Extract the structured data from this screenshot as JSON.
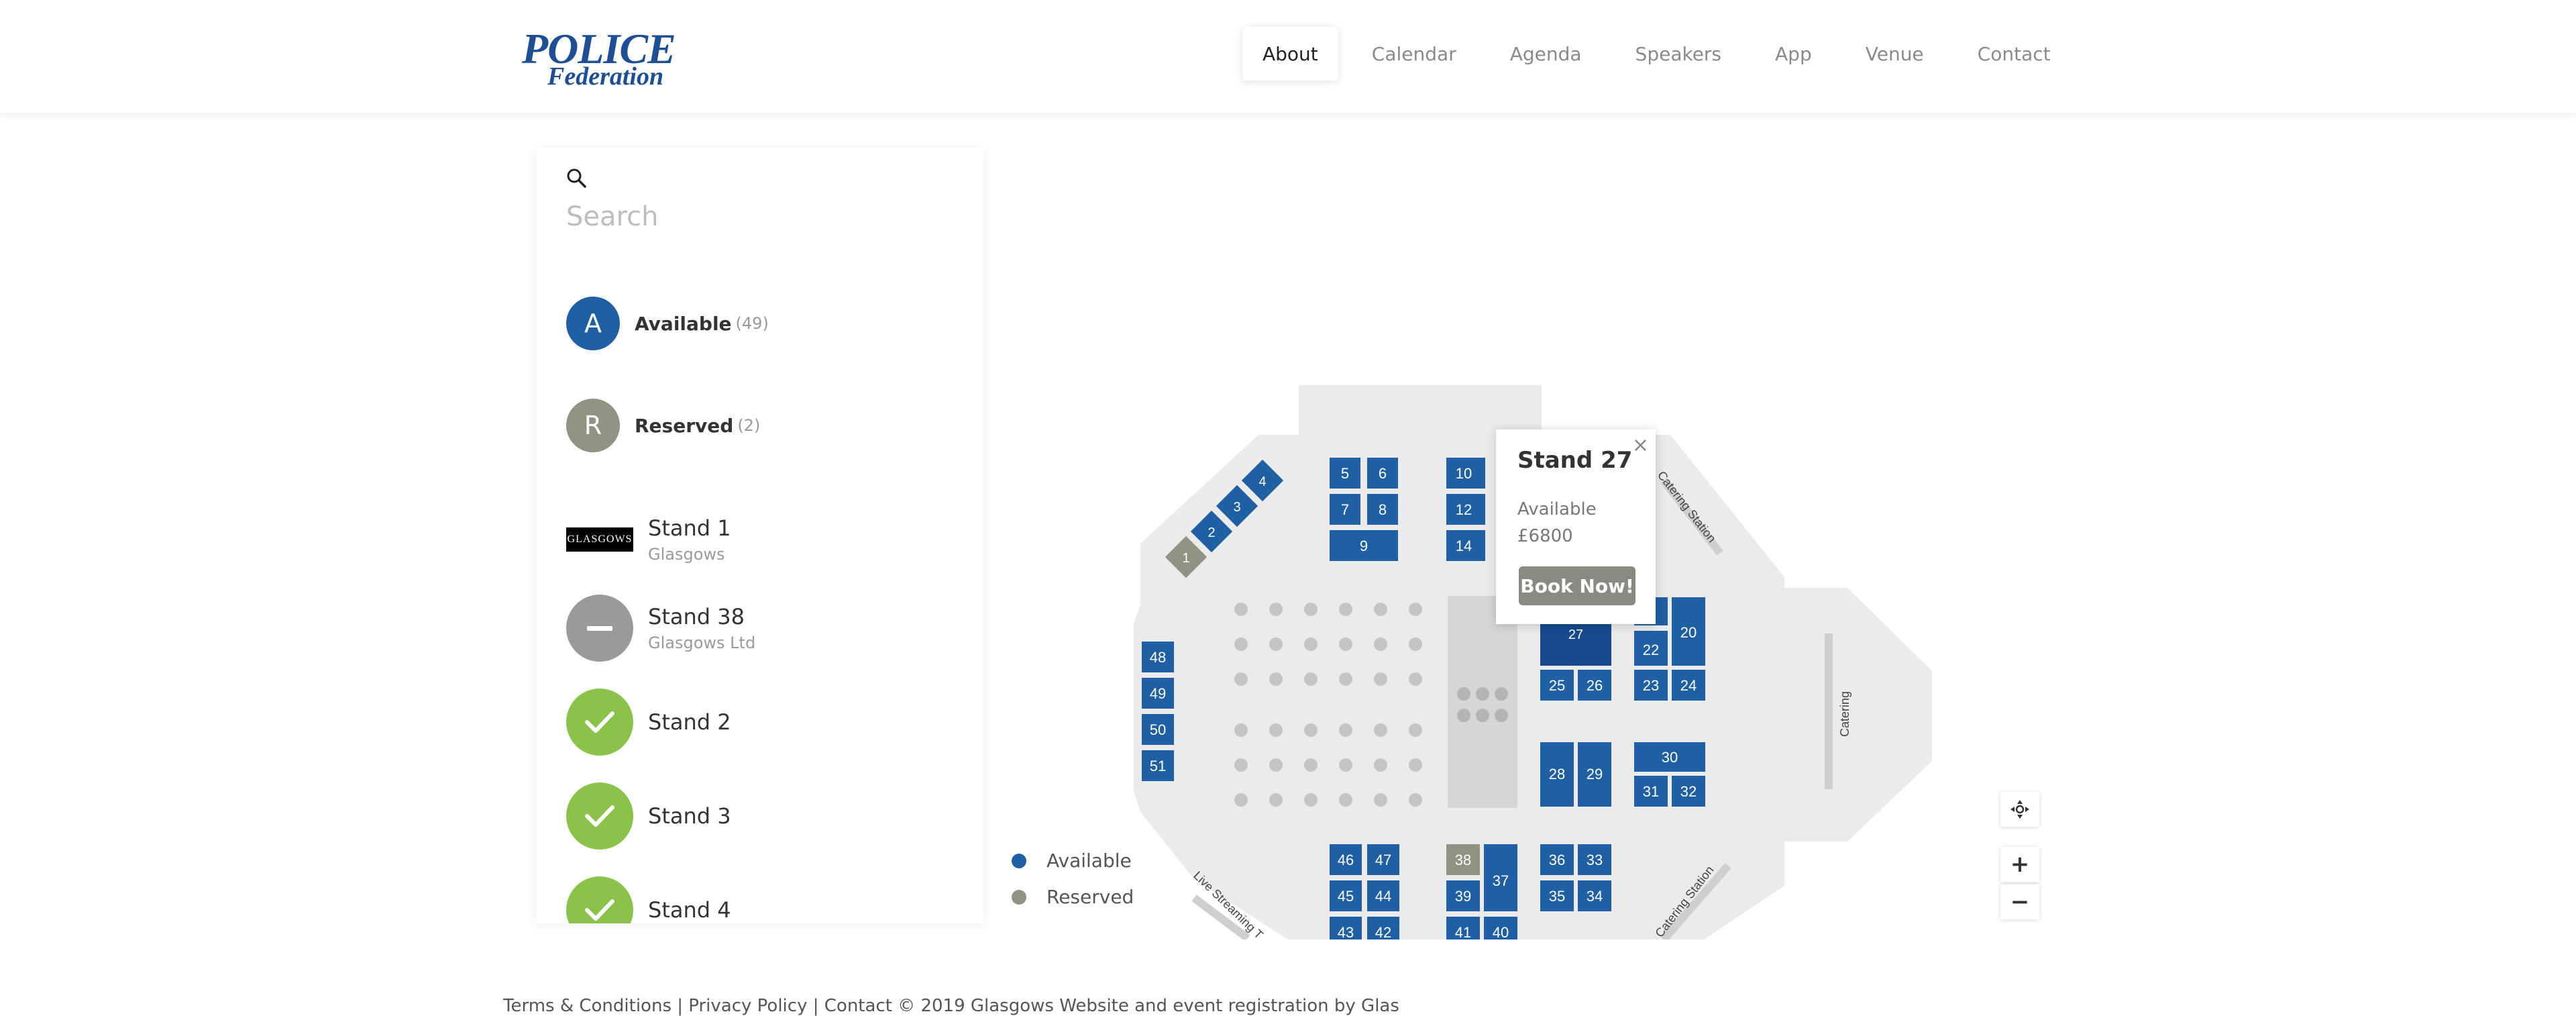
{
  "header": {
    "logo_main": "POLICE",
    "logo_sub": "Federation",
    "nav": [
      "About",
      "Calendar",
      "Agenda",
      "Speakers",
      "App",
      "Venue",
      "Contact"
    ],
    "active_nav": "About"
  },
  "sidebar": {
    "search_placeholder": "Search",
    "legend": [
      {
        "letter": "A",
        "label": "Available",
        "count": "(49)",
        "color": "#1f5fa3"
      },
      {
        "letter": "R",
        "label": "Reserved",
        "count": "(2)",
        "color": "#8f9482"
      }
    ],
    "stands": [
      {
        "title": "Stand 1",
        "sub": "Glasgows",
        "icon": "glasgows-logo",
        "logo_text": "GLASGOWS"
      },
      {
        "title": "Stand 38",
        "sub": "Glasgows Ltd",
        "icon": "minus-icon"
      },
      {
        "title": "Stand 2",
        "sub": "",
        "icon": "check-icon"
      },
      {
        "title": "Stand 3",
        "sub": "",
        "icon": "check-icon"
      },
      {
        "title": "Stand 4",
        "sub": "",
        "icon": "check-icon"
      }
    ]
  },
  "map": {
    "legend": [
      {
        "label": "Available",
        "color": "#1f5fa3"
      },
      {
        "label": "Reserved",
        "color": "#8f9482"
      }
    ],
    "labels": {
      "catering_station_1": "Catering Station",
      "catering_station_2": "Catering Station",
      "catering": "Catering",
      "live_streaming": "Live Streaming T"
    },
    "stands": [
      "1",
      "2",
      "3",
      "4",
      "5",
      "6",
      "7",
      "8",
      "9",
      "10",
      "12",
      "14",
      "20",
      "22",
      "23",
      "24",
      "25",
      "26",
      "27",
      "28",
      "29",
      "30",
      "31",
      "32",
      "33",
      "34",
      "35",
      "36",
      "37",
      "38",
      "39",
      "40",
      "41",
      "42",
      "43",
      "44",
      "45",
      "46",
      "47",
      "48",
      "49",
      "50",
      "51"
    ],
    "colors": {
      "available": "#1f5fa3",
      "reserved": "#8f9482",
      "floor": "#ebebeb",
      "aisle": "#d6d6d6"
    }
  },
  "popup": {
    "title": "Stand 27",
    "status": "Available",
    "price": "£6800",
    "button": "Book Now!",
    "close": "×"
  },
  "controls": {
    "zoom_in": "+",
    "zoom_out": "−"
  },
  "footer": {
    "text": "Terms & Conditions | Privacy Policy | Contact © 2019 Glasgows Website and event registration by Glas"
  }
}
